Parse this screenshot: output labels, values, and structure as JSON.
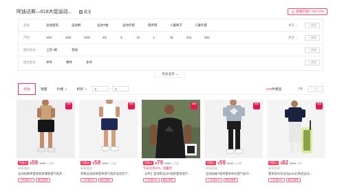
{
  "header": {
    "shop_title": "阿迪达斯—618大促运动...",
    "follow_label": "关注",
    "favorite_label": "收藏店铺(7,254,243)"
  },
  "filters": {
    "rows": [
      {
        "label": "品类",
        "options": [
          "运动套装",
          "运动裤",
          "运动T恤",
          "运动外套",
          "跑步鞋",
          "儿童裤子",
          "儿童外套"
        ],
        "more": "更多",
        "multi": "+ 多选"
      },
      {
        "label": "尺码",
        "options": [
          "4XS",
          "3XS",
          "XXS",
          "XS",
          "S",
          "M",
          "L",
          "XL",
          "2XL",
          "3XL"
        ],
        "more": "更多",
        "multi": "+ 多选"
      },
      {
        "label": "服装款式",
        "options": [
          "上衣+裤",
          "其他"
        ],
        "more": "",
        "multi": "+ 多选"
      },
      {
        "label": "组合套装",
        "options": [
          "单件",
          "两件",
          "多件"
        ],
        "more": "",
        "multi": "+ 多选"
      }
    ],
    "more_options": "更多选项"
  },
  "sortbar": {
    "items": [
      "综合",
      "销量",
      "价格",
      "折扣"
    ],
    "price_min_placeholder": "¥",
    "price_max_placeholder": "¥",
    "price_sep": "-",
    "result_count": "209",
    "result_suffix": "件商品",
    "page_current": "1",
    "page_total": "/1",
    "prev": "‹",
    "next": "›"
  },
  "products": [
    {
      "badge": "618",
      "tag": "特惠价",
      "price": "59",
      "orig": "¥349",
      "discount": "2.4折",
      "sub": "60天低价",
      "sub_red": false,
      "desc": "运动短裤男夏季新款薄款透气跑步...",
      "chips": [
        "已优惠¥40",
        "精品推荐"
      ]
    },
    {
      "badge": "618",
      "tag": "特惠价",
      "price": "59",
      "orig": "¥249",
      "discount": "2.4折",
      "sub": "60天低价",
      "sub_red": false,
      "desc": "男裤运动短裤夏季透气跑步运动型下...",
      "chips": [
        "已优惠¥40",
        "精品推荐"
      ]
    },
    {
      "badge": "618",
      "tag": "特惠价",
      "price": "79",
      "orig": "¥349",
      "discount": "2.3折",
      "sub": "今天20点¥73，限量抢",
      "sub_red": true,
      "desc": "【4件】篮球新运动T恤男夏季速干...",
      "chips": [
        "已优惠¥40",
        "精品推荐"
      ]
    },
    {
      "badge": "618",
      "tag": "特惠价",
      "price": "59",
      "orig": "¥249",
      "discount": "2.4折",
      "sub": "60天低价",
      "sub_red": false,
      "desc": "运动短袖T恤男夏季休闲透气吸汗...",
      "chips": [
        "已优惠¥40",
        "精品推荐"
      ]
    },
    {
      "badge": "618",
      "tag": "特惠价",
      "price": "82",
      "orig": "¥349",
      "discount": "2折",
      "sub": "60天低价",
      "sub_red": false,
      "desc": "夏季高尔夫运动polo衫男式运动...",
      "chips": [
        "已优惠¥40",
        "精品推荐"
      ]
    }
  ],
  "colors": {
    "accent": "#ff2e55",
    "badge": "#e8174e"
  }
}
